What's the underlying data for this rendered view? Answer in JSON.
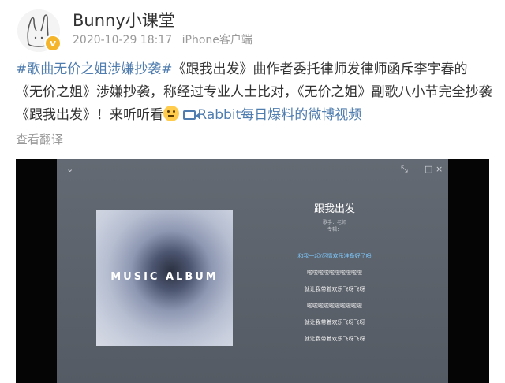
{
  "post": {
    "username": "Bunny小课堂",
    "date": "2020-10-29 18:17",
    "client": "iPhone客户端",
    "verified_badge": "v",
    "hashtag": "#歌曲无价之姐涉嫌抄袭#",
    "text_main": "《跟我出发》曲作者委托律师发律师函斥李宇春的《无价之姐》涉嫌抄袭，称经过专业人士比对，《无价之姐》副歌八小节完全抄袭《跟我出发》！来听听看",
    "emoji": "smile-emoji",
    "video_link": "Rabbit每日爆料的微博视频",
    "translate": "查看翻译"
  },
  "player": {
    "album_text": "MUSIC ALBUM",
    "song_title": "跟我出发",
    "song_artist": "歌手：老师",
    "song_album": "专辑：",
    "lyrics": [
      "和我一起/尽情欢乐准备好了吗",
      "啦啦啦啦啦啦啦啦啦啦",
      "就让我带着欢乐飞呀飞呀",
      "啦啦啦啦啦啦啦啦啦啦",
      "就让我带着欢乐飞呀飞呀",
      "就让我带着欢乐飞呀飞呀"
    ],
    "active_lyric_index": 0,
    "controls": {
      "collapse": "⌄",
      "shrink": "⤡",
      "minimize": "−",
      "maximize": "□",
      "close": "×"
    }
  },
  "colors": {
    "link": "#507daf",
    "text": "#333333",
    "meta": "#999999",
    "active_lyric": "#7dc9ff"
  }
}
